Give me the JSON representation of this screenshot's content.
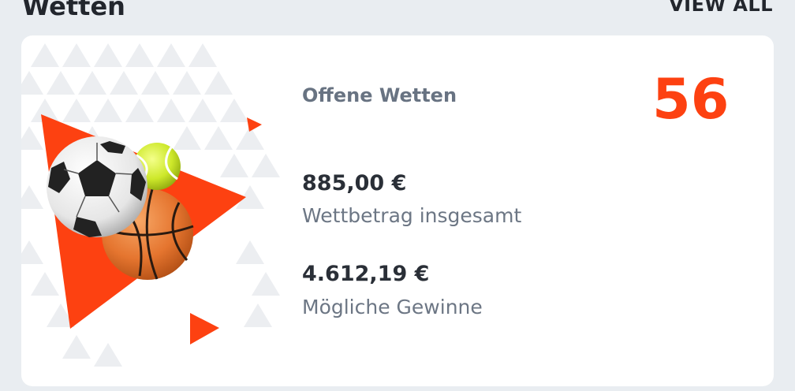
{
  "header": {
    "title": "Wetten",
    "view_all_label": "VIEW ALL"
  },
  "card": {
    "open_bets_label": "Offene Wetten",
    "open_bets_count": "56",
    "total_stake_value": "885,00 €",
    "total_stake_label": "Wettbetrag insgesamt",
    "possible_winnings_value": "4.612,19 €",
    "possible_winnings_label": "Mögliche Gewinne"
  },
  "colors": {
    "accent": "#fd4111",
    "background": "#e9edf1",
    "card": "#ffffff",
    "text_dark": "#2a2f37",
    "text_muted": "#6c7684"
  },
  "icons": [
    "soccer-ball-icon",
    "tennis-ball-icon",
    "basketball-icon",
    "play-triangle-icon"
  ]
}
